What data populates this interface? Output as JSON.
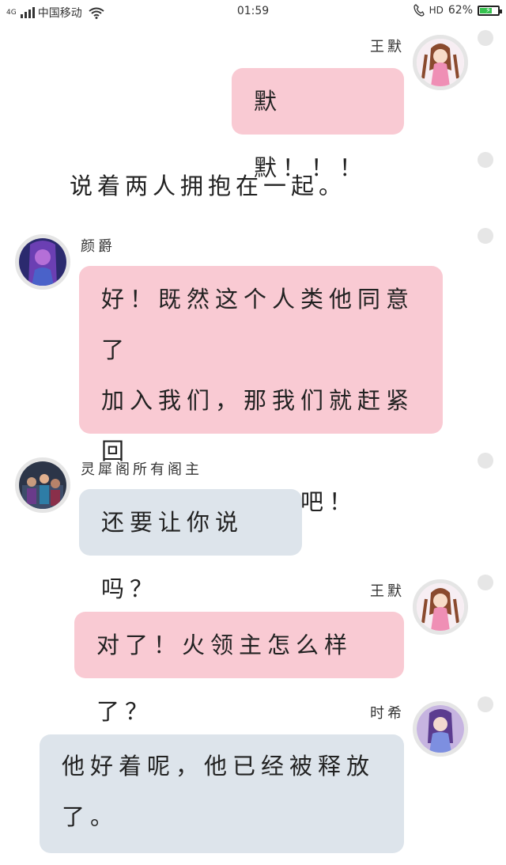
{
  "status_bar": {
    "network": "4G",
    "carrier": "中国移动",
    "time": "01:59",
    "hd": "HD",
    "battery_percent": "62%",
    "battery_level": 0.62
  },
  "messages": [
    {
      "sender": "王默",
      "text": "默默！！！",
      "side": "right",
      "color": "pink"
    },
    {
      "narration": "说着两人拥抱在一起。"
    },
    {
      "sender": "颜爵",
      "lines": [
        "好！既然这个人类他同意了",
        "加入我们，那我们就赶紧回",
        "去举行灵犀仪式吧！"
      ],
      "side": "left",
      "color": "pink"
    },
    {
      "sender": "灵犀阁所有阁主",
      "text": "还要让你说吗？",
      "side": "left",
      "color": "gray"
    },
    {
      "sender": "王默",
      "text": "对了！火领主怎么样了？",
      "side": "right",
      "color": "pink"
    },
    {
      "sender": "时希",
      "lines": [
        "他好着呢，他已经被释放",
        "了。"
      ],
      "side": "right",
      "color": "gray"
    }
  ],
  "icons": [
    "signal-icon",
    "wifi-icon",
    "phone-icon",
    "battery-icon"
  ],
  "colors": {
    "pink_bubble": "#f9cad3",
    "gray_bubble": "#dde4eb",
    "avatar_border": "#e5e5e5",
    "dot": "#e6e6e6"
  }
}
